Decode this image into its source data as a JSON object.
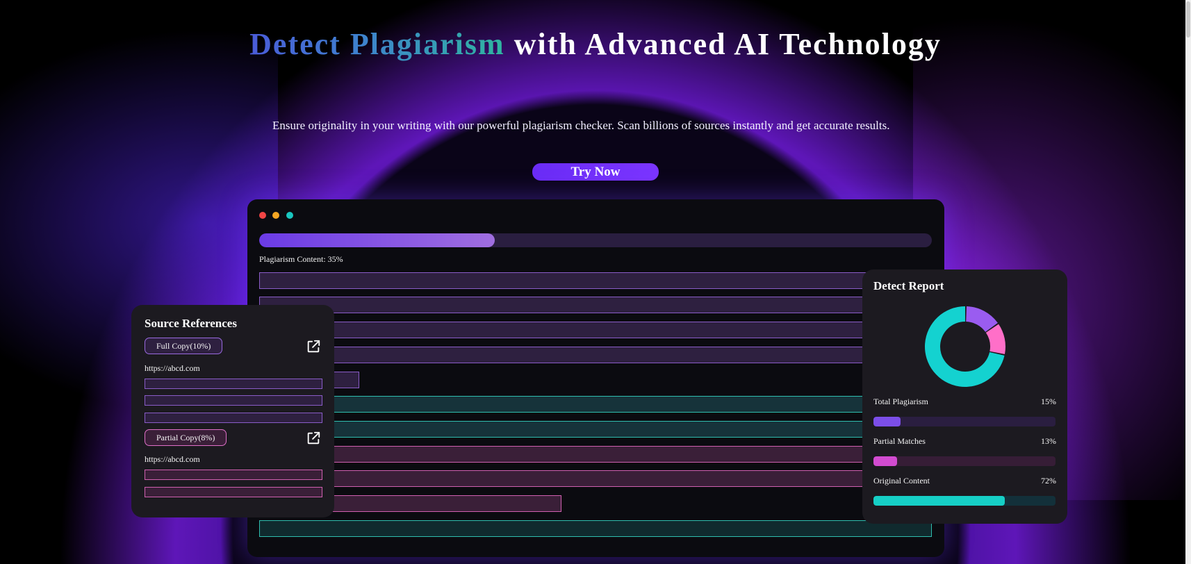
{
  "hero": {
    "title_accent": "Detect Plagiarism",
    "title_rest": " with Advanced AI Technology",
    "subtitle": "Ensure originality in your writing with our powerful plagiarism checker. Scan billions of sources instantly and get accurate results.",
    "cta_label": "Try Now"
  },
  "window": {
    "dots": [
      "#f04545",
      "#f5a623",
      "#19c6c0"
    ],
    "progress": {
      "label": "Plagiarism Content: 35%",
      "fraction": 0.35
    }
  },
  "source_references": {
    "title": "Source References",
    "groups": [
      {
        "tag": "Full Copy(10%)",
        "url": "https://abcd.com",
        "icon": "external-link-icon"
      },
      {
        "tag": "Partial Copy(8%)",
        "url": "https://abcd.com",
        "icon": "external-link-icon"
      }
    ]
  },
  "detect_report": {
    "title": "Detect Report",
    "stats": [
      {
        "label": "Total Plagiarism",
        "value": "15%",
        "fraction": 0.15,
        "color": "#7b4ee8"
      },
      {
        "label": "Partial Matches",
        "value": "13%",
        "fraction": 0.13,
        "color": "#d24bd0"
      },
      {
        "label": "Original Content",
        "value": "72%",
        "fraction": 0.72,
        "color": "#16cfc6"
      }
    ],
    "donut": [
      {
        "name": "Total Plagiarism",
        "value": 15,
        "color": "#9a5cf0"
      },
      {
        "name": "Partial Matches",
        "value": 13,
        "color": "#ff6fc8"
      },
      {
        "name": "Original Content",
        "value": 72,
        "color": "#14d2d0"
      }
    ]
  },
  "colors": {
    "accent_purple": "#6a2cf5",
    "teal": "#16cfc6",
    "pink": "#d24bd0"
  }
}
